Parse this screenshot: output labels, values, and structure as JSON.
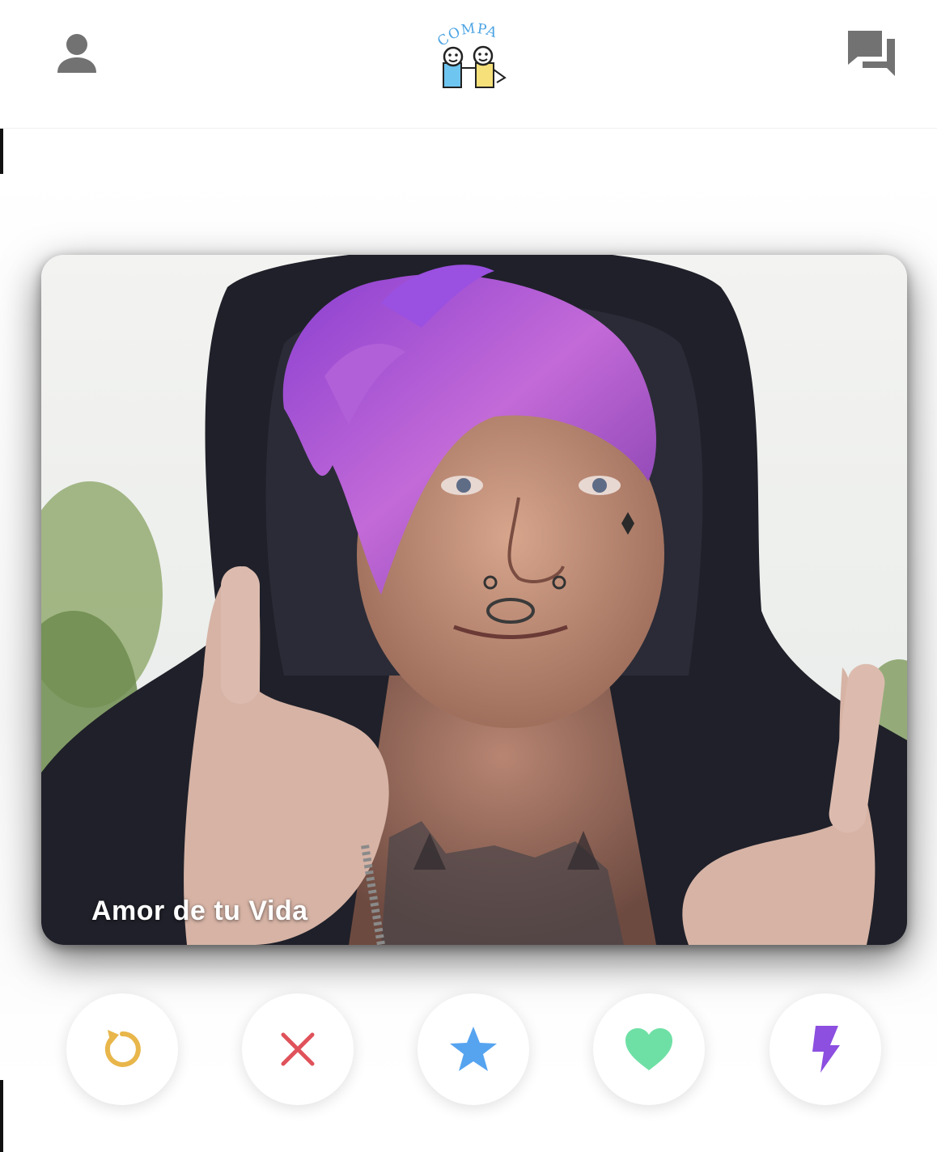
{
  "app": {
    "logo_text": "COMPA"
  },
  "header": {
    "profile_icon": "person-icon",
    "chat_icon": "chat-bubbles-icon"
  },
  "card": {
    "name": "Amor de tu Vida"
  },
  "actions": [
    {
      "icon": "rewind-icon",
      "color": "#e8b64a"
    },
    {
      "icon": "close-icon",
      "color": "#e0525a"
    },
    {
      "icon": "star-icon",
      "color": "#56a4f0"
    },
    {
      "icon": "heart-icon",
      "color": "#6fe0a5"
    },
    {
      "icon": "lightning-icon",
      "color": "#8c4fe0"
    }
  ],
  "colors": {
    "icon_gray": "#727272"
  }
}
